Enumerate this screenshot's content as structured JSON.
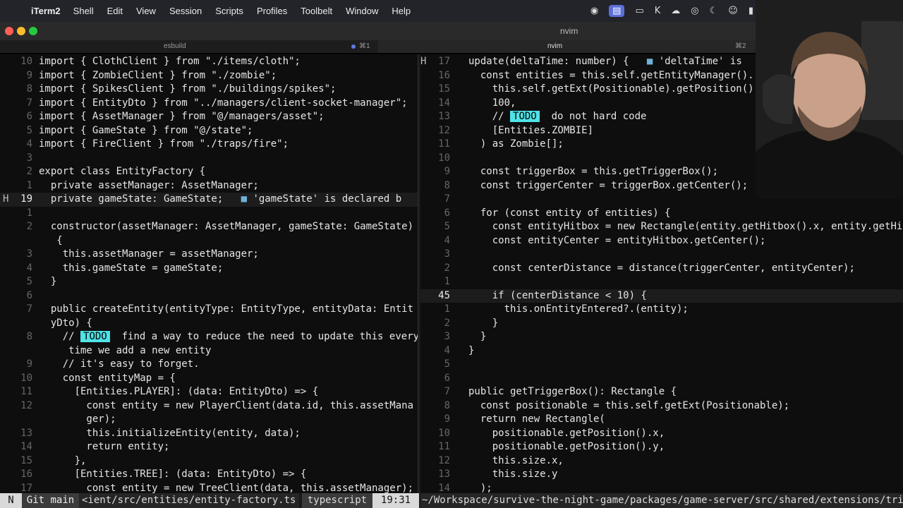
{
  "menubar": {
    "app_name": "iTerm2",
    "menus": [
      "Shell",
      "Edit",
      "View",
      "Session",
      "Scripts",
      "Profiles",
      "Toolbelt",
      "Window",
      "Help"
    ],
    "tray_icons": [
      "obs-icon",
      "screen-icon",
      "display-icon",
      "k-icon",
      "cloud-icon",
      "record-icon",
      "moon-icon",
      "user-icon",
      "battery-icon",
      "wifi-icon"
    ]
  },
  "window": {
    "title": "nvim"
  },
  "tabs": [
    {
      "label": "esbuild",
      "shortcut": "⌘1"
    },
    {
      "label": "nvim",
      "shortcut": "⌘2"
    }
  ],
  "left_pane": {
    "lines": [
      {
        "num": "10",
        "code": "import { ClothClient } from \"./items/cloth\";"
      },
      {
        "num": "9",
        "code": "import { ZombieClient } from \"./zombie\";"
      },
      {
        "num": "8",
        "code": "import { SpikesClient } from \"./buildings/spikes\";"
      },
      {
        "num": "7",
        "code": "import { EntityDto } from \"../managers/client-socket-manager\";"
      },
      {
        "num": "6",
        "code": "import { AssetManager } from \"@/managers/asset\";"
      },
      {
        "num": "5",
        "code": "import { GameState } from \"@/state\";"
      },
      {
        "num": "4",
        "code": "import { FireClient } from \"./traps/fire\";"
      },
      {
        "num": "3",
        "code": ""
      },
      {
        "num": "2",
        "code": "export class EntityFactory {"
      },
      {
        "num": "1",
        "code": "  private assetManager: AssetManager;"
      },
      {
        "num": "19",
        "mark": "H",
        "current": true,
        "code": "  private gameState: GameState;   ■ 'gameState' is declared b"
      },
      {
        "num": "1",
        "code": ""
      },
      {
        "num": "2",
        "code": "  constructor(assetManager: AssetManager, gameState: GameState)"
      },
      {
        "num": "",
        "code": "   {"
      },
      {
        "num": "3",
        "code": "    this.assetManager = assetManager;"
      },
      {
        "num": "4",
        "code": "    this.gameState = gameState;"
      },
      {
        "num": "5",
        "code": "  }"
      },
      {
        "num": "6",
        "code": ""
      },
      {
        "num": "7",
        "code": "  public createEntity(entityType: EntityType, entityData: Entit"
      },
      {
        "num": "",
        "code": "  yDto) {"
      },
      {
        "num": "8",
        "code": "    // TODO  find a way to reduce the need to update this every"
      },
      {
        "num": "",
        "code": "     time we add a new entity"
      },
      {
        "num": "9",
        "code": "    // it's easy to forget."
      },
      {
        "num": "10",
        "code": "    const entityMap = {"
      },
      {
        "num": "11",
        "code": "      [Entities.PLAYER]: (data: EntityDto) => {"
      },
      {
        "num": "12",
        "code": "        const entity = new PlayerClient(data.id, this.assetMana"
      },
      {
        "num": "",
        "code": "        ger);"
      },
      {
        "num": "13",
        "code": "        this.initializeEntity(entity, data);"
      },
      {
        "num": "14",
        "code": "        return entity;"
      },
      {
        "num": "15",
        "code": "      },"
      },
      {
        "num": "16",
        "code": "      [Entities.TREE]: (data: EntityDto) => {"
      },
      {
        "num": "17",
        "code": "        const entity = new TreeClient(data, this.assetManager);"
      }
    ]
  },
  "right_pane": {
    "lines": [
      {
        "num": "17",
        "mark": "H",
        "code": "update(deltaTime: number) {   ■ 'deltaTime' is"
      },
      {
        "num": "16",
        "code": "  const entities = this.self.getEntityManager()."
      },
      {
        "num": "15",
        "code": "    this.self.getExt(Positionable).getPosition()"
      },
      {
        "num": "14",
        "code": "    100,"
      },
      {
        "num": "13",
        "code": "    // TODO  do not hard code"
      },
      {
        "num": "12",
        "code": "    [Entities.ZOMBIE]"
      },
      {
        "num": "11",
        "code": "  ) as Zombie[];"
      },
      {
        "num": "10",
        "code": ""
      },
      {
        "num": "9",
        "code": "  const triggerBox = this.getTriggerBox();"
      },
      {
        "num": "8",
        "code": "  const triggerCenter = triggerBox.getCenter();"
      },
      {
        "num": "7",
        "code": ""
      },
      {
        "num": "6",
        "code": "  for (const entity of entities) {"
      },
      {
        "num": "5",
        "code": "    const entityHitbox = new Rectangle(entity.getHitbox().x, entity.getHi"
      },
      {
        "num": "4",
        "code": "    const entityCenter = entityHitbox.getCenter();"
      },
      {
        "num": "3",
        "code": ""
      },
      {
        "num": "2",
        "code": "    const centerDistance = distance(triggerCenter, entityCenter);"
      },
      {
        "num": "1",
        "code": ""
      },
      {
        "num": "45",
        "current": true,
        "code": "    if (centerDistance < 10) {"
      },
      {
        "num": "1",
        "code": "      this.onEntityEntered?.(entity);"
      },
      {
        "num": "2",
        "code": "    }"
      },
      {
        "num": "3",
        "code": "  }"
      },
      {
        "num": "4",
        "code": "}"
      },
      {
        "num": "5",
        "code": ""
      },
      {
        "num": "6",
        "code": ""
      },
      {
        "num": "7",
        "code": "public getTriggerBox(): Rectangle {"
      },
      {
        "num": "8",
        "code": "  const positionable = this.self.getExt(Positionable);"
      },
      {
        "num": "9",
        "code": "  return new Rectangle("
      },
      {
        "num": "10",
        "code": "    positionable.getPosition().x,"
      },
      {
        "num": "11",
        "code": "    positionable.getPosition().y,"
      },
      {
        "num": "12",
        "code": "    this.size.x,"
      },
      {
        "num": "13",
        "code": "    this.size.y"
      },
      {
        "num": "14",
        "code": "  );"
      }
    ]
  },
  "statusline": {
    "mode": "N",
    "git": "Git main",
    "file": "<ient/src/entities/entity-factory.ts",
    "filetype": "typescript",
    "position": "19:31",
    "path": "~/Workspace/survive-the-night-game/packages/game-server/src/shared/extensions/tri"
  },
  "colors": {
    "todo_bg": "#4fe3e8",
    "todo_fg": "#000000",
    "diag_square": "#6fb2d6"
  }
}
